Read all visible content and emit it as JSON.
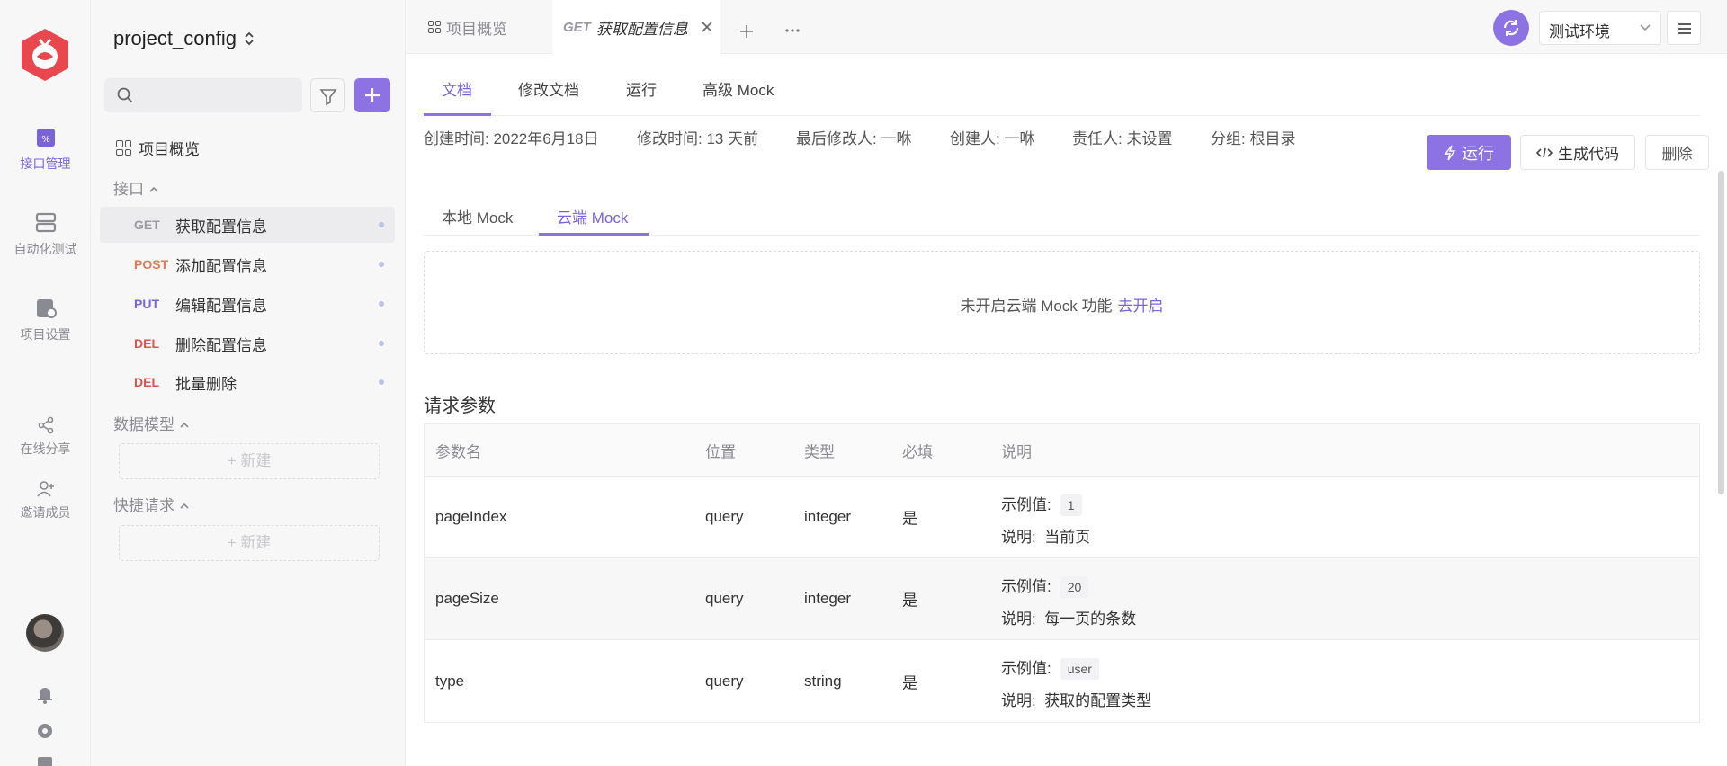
{
  "rail": {
    "items": [
      {
        "label": "接口管理"
      },
      {
        "label": "自动化测试"
      },
      {
        "label": "项目设置"
      },
      {
        "label": "在线分享"
      },
      {
        "label": "邀请成员"
      }
    ]
  },
  "sidebar": {
    "project_name": "project_config",
    "overview_label": "项目概览",
    "section_api": "接口",
    "apis": [
      {
        "method": "GET",
        "name": "获取配置信息",
        "color": "#9a9aa2"
      },
      {
        "method": "POST",
        "name": "添加配置信息",
        "color": "#e07b56"
      },
      {
        "method": "PUT",
        "name": "编辑配置信息",
        "color": "#7a63d8"
      },
      {
        "method": "DEL",
        "name": "删除配置信息",
        "color": "#d9534f"
      },
      {
        "method": "DEL",
        "name": "批量删除",
        "color": "#d9534f"
      }
    ],
    "section_models": "数据模型",
    "section_quick": "快捷请求",
    "new_label": "新建"
  },
  "topbar": {
    "tab_overview": "项目概览",
    "tab_active_method": "GET",
    "tab_active_title": "获取配置信息",
    "env_label": "测试环境"
  },
  "doc": {
    "tabs": [
      "文档",
      "修改文档",
      "运行",
      "高级 Mock"
    ],
    "meta": [
      "创建时间: 2022年6月18日",
      "修改时间: 13 天前",
      "最后修改人: 一咻",
      "创建人: 一咻",
      "责任人: 未设置",
      "分组: 根目录"
    ],
    "run_label": "运行",
    "gen_code_label": "生成代码",
    "delete_label": "删除",
    "mock_tabs": [
      "本地 Mock",
      "云端 Mock"
    ],
    "cloud_msg": "未开启云端 Mock 功能",
    "cloud_link": "去开启",
    "req_params_title": "请求参数",
    "table_headers": [
      "参数名",
      "位置",
      "类型",
      "必填",
      "说明"
    ],
    "example_label": "示例值:",
    "desc_label": "说明:",
    "params": [
      {
        "name": "pageIndex",
        "in": "query",
        "type": "integer",
        "required": "是",
        "example": "1",
        "desc": "当前页"
      },
      {
        "name": "pageSize",
        "in": "query",
        "type": "integer",
        "required": "是",
        "example": "20",
        "desc": "每一页的条数"
      },
      {
        "name": "type",
        "in": "query",
        "type": "string",
        "required": "是",
        "example": "user",
        "desc": "获取的配置类型"
      }
    ]
  },
  "colors": {
    "accent": "#8d72e3"
  }
}
